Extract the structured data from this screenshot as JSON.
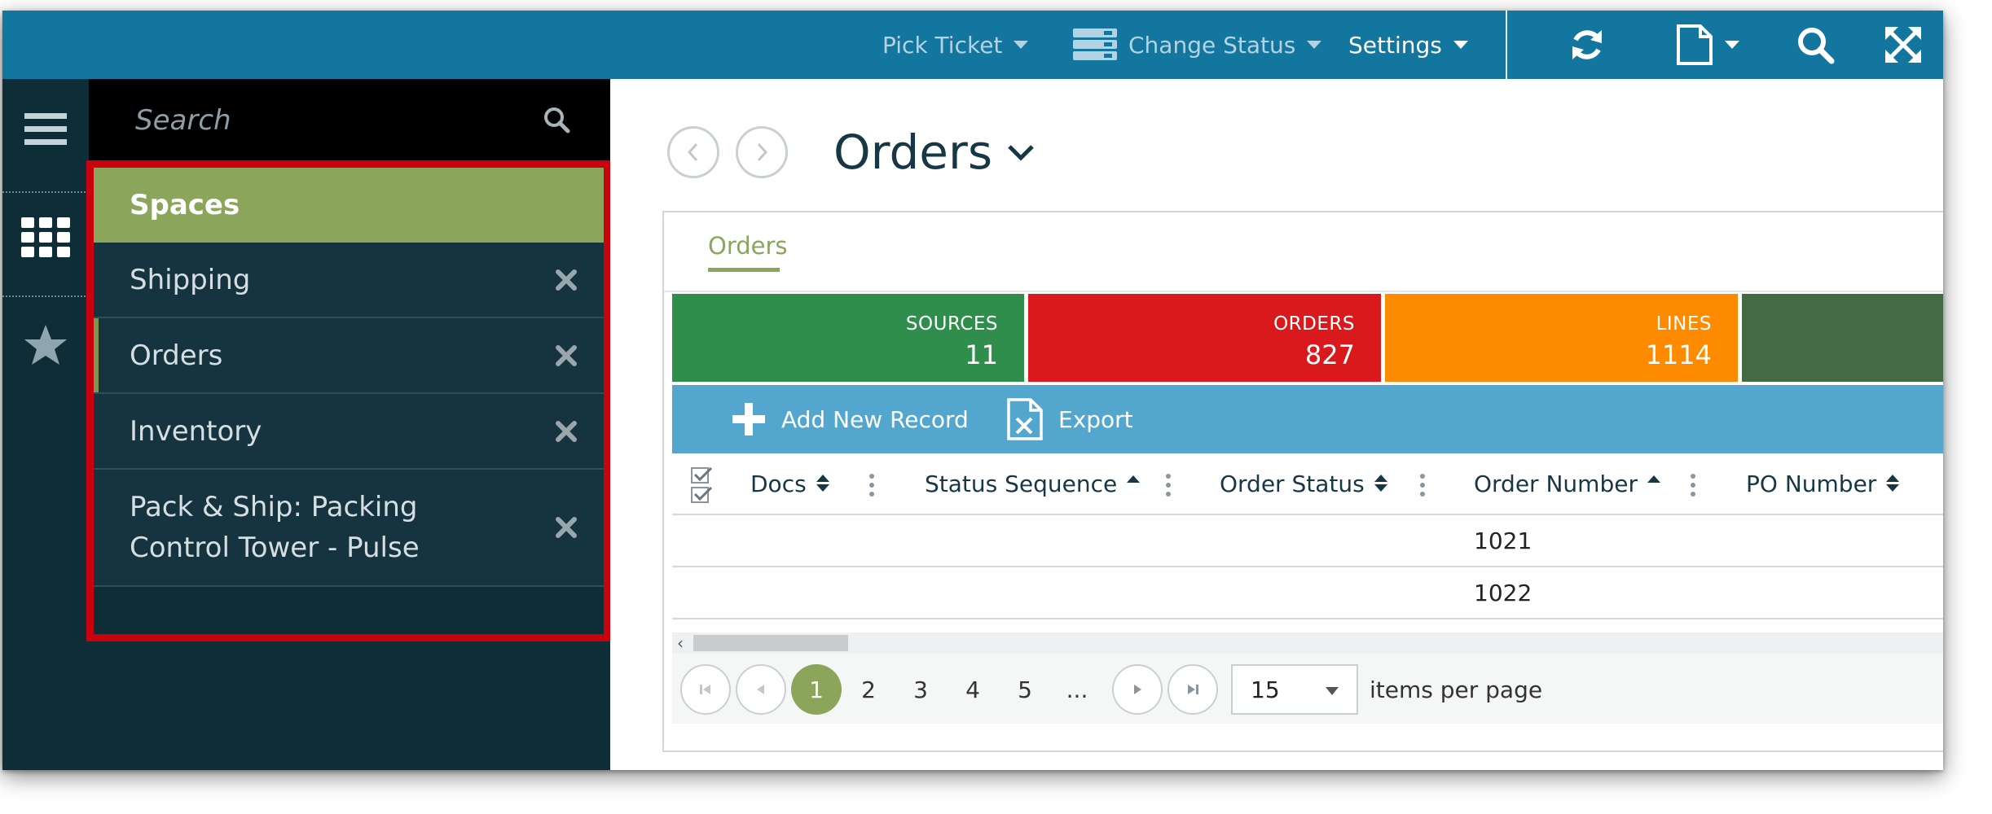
{
  "topbar": {
    "pick_ticket": "Pick Ticket",
    "change_status": "Change Status",
    "settings": "Settings",
    "icons": [
      "refresh-icon",
      "document-icon",
      "search-icon",
      "expand-icon"
    ]
  },
  "rail": {
    "icons": [
      "hamburger-menu-icon",
      "apps-grid-icon",
      "star-icon"
    ]
  },
  "sidebar": {
    "search_placeholder": "Search",
    "items": [
      {
        "label": "Spaces"
      },
      {
        "label": "Shipping"
      },
      {
        "label": "Orders"
      },
      {
        "label": "Inventory"
      },
      {
        "label_line1": "Pack & Ship: Packing",
        "label_line2": "Control Tower - Pulse"
      }
    ]
  },
  "content": {
    "title": "Orders",
    "tab": "Orders",
    "tiles": [
      {
        "label": "SOURCES",
        "value": "11",
        "color": "#2f8e4b"
      },
      {
        "label": "ORDERS",
        "value": "827",
        "color": "#d9191b"
      },
      {
        "label": "LINES",
        "value": "1114",
        "color": "#fe8a00"
      },
      {
        "color": "#436a42"
      }
    ],
    "toolbar": {
      "add": "Add New Record",
      "export": "Export"
    },
    "columns": [
      "Docs",
      "Status Sequence",
      "Order Status",
      "Order Number",
      "PO Number"
    ],
    "rows": [
      {
        "order_number": "1021"
      },
      {
        "order_number": "1022"
      }
    ],
    "pager": {
      "pages": [
        "1",
        "2",
        "3",
        "4",
        "5",
        "..."
      ],
      "per_page": "15",
      "per_page_label": "items per page"
    }
  },
  "colors": {
    "topbar": "#13769f",
    "sidebar": "#0f2d37",
    "accent_green": "#8ba65b",
    "toolbar_blue": "#53a6cd",
    "highlight_red": "#c9020d"
  }
}
